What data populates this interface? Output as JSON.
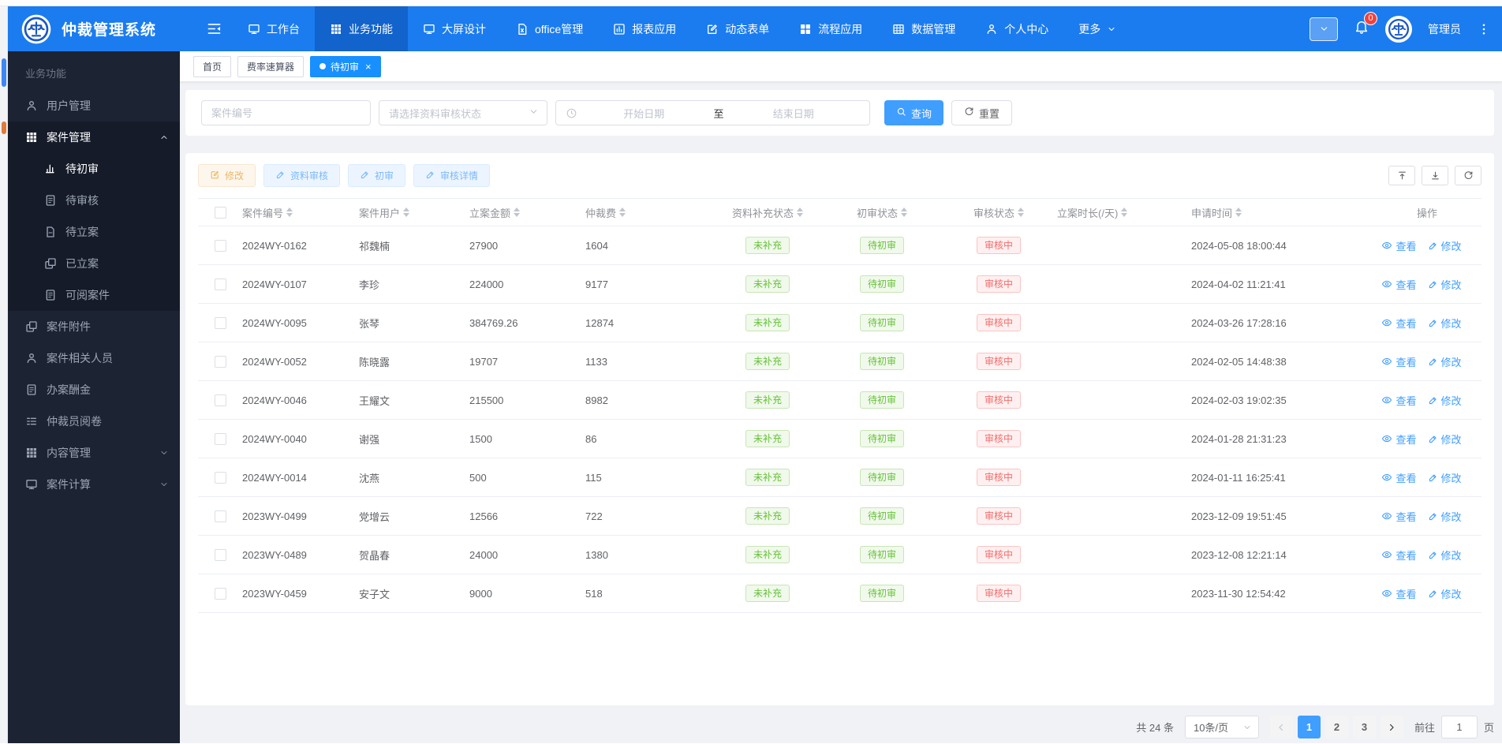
{
  "app": {
    "title": "仲裁管理系统"
  },
  "colors": {
    "navbar_blue": "#1b7cf0",
    "navbar_active_blue": "#1263cb",
    "primary": "#409eff",
    "tab_active_blue": "#1890ff",
    "sidebar_bg": "#1c2333",
    "badge_green": "#67c23a",
    "badge_green_bg": "#f0f9eb",
    "badge_red": "#f56c6c",
    "badge_red_bg": "#fef0f0",
    "warn_orange": "#ecb869",
    "notification_red": "#f5413d"
  },
  "navbar": {
    "items": [
      {
        "id": "workbench",
        "label": "工作台",
        "icon": "monitor"
      },
      {
        "id": "business",
        "label": "业务功能",
        "icon": "grid",
        "active": true
      },
      {
        "id": "screen-design",
        "label": "大屏设计",
        "icon": "monitor"
      },
      {
        "id": "office",
        "label": "office管理",
        "icon": "file-x"
      },
      {
        "id": "report",
        "label": "报表应用",
        "icon": "bar-chart"
      },
      {
        "id": "dynamic-form",
        "label": "动态表单",
        "icon": "edit"
      },
      {
        "id": "workflow",
        "label": "流程应用",
        "icon": "blocks"
      },
      {
        "id": "data-mgmt",
        "label": "数据管理",
        "icon": "table"
      },
      {
        "id": "profile",
        "label": "个人中心",
        "icon": "user"
      },
      {
        "id": "more",
        "label": "更多",
        "chevron": true
      }
    ],
    "notification_count": "0",
    "username": "管理员"
  },
  "sidebar": {
    "section_title": "业务功能",
    "items": [
      {
        "id": "user-mgmt",
        "label": "用户管理",
        "icon": "user"
      },
      {
        "id": "case-mgmt",
        "label": "案件管理",
        "icon": "grid",
        "expanded": true,
        "active": true,
        "children": [
          {
            "id": "pending-initial-review",
            "label": "待初审",
            "icon": "chart",
            "active": true
          },
          {
            "id": "pending-review",
            "label": "待审核",
            "icon": "doc-lines"
          },
          {
            "id": "pending-filing",
            "label": "待立案",
            "icon": "doc"
          },
          {
            "id": "filed",
            "label": "已立案",
            "icon": "copy"
          },
          {
            "id": "readable-cases",
            "label": "可阅案件",
            "icon": "doc-lines"
          }
        ]
      },
      {
        "id": "case-attachments",
        "label": "案件附件",
        "icon": "copy"
      },
      {
        "id": "case-related-persons",
        "label": "案件相关人员",
        "icon": "user"
      },
      {
        "id": "case-remuneration",
        "label": "办案酬金",
        "icon": "doc-lines"
      },
      {
        "id": "arbitrator-file-review",
        "label": "仲裁员阅卷",
        "icon": "list"
      },
      {
        "id": "content-mgmt",
        "label": "内容管理",
        "icon": "grid",
        "collapsed": true
      },
      {
        "id": "case-calculation",
        "label": "案件计算",
        "icon": "monitor",
        "collapsed": true
      }
    ]
  },
  "tabs": [
    {
      "id": "home",
      "label": "首页"
    },
    {
      "id": "rate-calculator",
      "label": "费率速算器"
    },
    {
      "id": "pending-initial-review",
      "label": "待初审",
      "active": true,
      "closable": true
    }
  ],
  "search": {
    "case_no_placeholder": "案件编号",
    "status_placeholder": "请选择资料审核状态",
    "start_date_placeholder": "开始日期",
    "date_separator": "至",
    "end_date_placeholder": "结束日期",
    "search_label": "查询",
    "reset_label": "重置"
  },
  "toolbar": {
    "buttons": [
      {
        "id": "edit",
        "label": "修改",
        "style": "warn",
        "icon": "edit"
      },
      {
        "id": "material-review",
        "label": "资料审核",
        "style": "blue",
        "icon": "pencil"
      },
      {
        "id": "initial-review",
        "label": "初审",
        "style": "blue",
        "icon": "pencil"
      },
      {
        "id": "review-detail",
        "label": "审核详情",
        "style": "blue",
        "icon": "pencil"
      }
    ]
  },
  "table": {
    "columns": [
      {
        "key": "select",
        "label": "",
        "type": "select"
      },
      {
        "key": "case_no",
        "label": "案件编号",
        "sortable": true,
        "type": "text"
      },
      {
        "key": "user",
        "label": "案件用户",
        "sortable": true,
        "type": "text"
      },
      {
        "key": "amount",
        "label": "立案金额",
        "sortable": true,
        "type": "text"
      },
      {
        "key": "fee",
        "label": "仲裁费",
        "sortable": true,
        "type": "text"
      },
      {
        "key": "supplement_status",
        "label": "资料补充状态",
        "sortable": true,
        "type": "badge"
      },
      {
        "key": "initial_status",
        "label": "初审状态",
        "sortable": true,
        "type": "badge"
      },
      {
        "key": "review_status",
        "label": "审核状态",
        "sortable": true,
        "type": "badge"
      },
      {
        "key": "duration_days",
        "label": "立案时长(/天)",
        "sortable": true,
        "type": "text"
      },
      {
        "key": "apply_time",
        "label": "申请时间",
        "sortable": true,
        "type": "text"
      },
      {
        "key": "actions",
        "label": "操作",
        "type": "actions"
      }
    ],
    "status_colors": {
      "未补充": "green",
      "待初审": "green",
      "审核中": "red"
    },
    "action_labels": {
      "view": "查看",
      "edit": "修改"
    },
    "rows": [
      {
        "case_no": "2024WY-0162",
        "user": "祁魏楠",
        "amount": "27900",
        "fee": "1604",
        "supplement_status": "未补充",
        "initial_status": "待初审",
        "review_status": "审核中",
        "duration_days": "",
        "apply_time": "2024-05-08 18:00:44"
      },
      {
        "case_no": "2024WY-0107",
        "user": "李珍",
        "amount": "224000",
        "fee": "9177",
        "supplement_status": "未补充",
        "initial_status": "待初审",
        "review_status": "审核中",
        "duration_days": "",
        "apply_time": "2024-04-02 11:21:41"
      },
      {
        "case_no": "2024WY-0095",
        "user": "张琴",
        "amount": "384769.26",
        "fee": "12874",
        "supplement_status": "未补充",
        "initial_status": "待初审",
        "review_status": "审核中",
        "duration_days": "",
        "apply_time": "2024-03-26 17:28:16"
      },
      {
        "case_no": "2024WY-0052",
        "user": "陈晓露",
        "amount": "19707",
        "fee": "1133",
        "supplement_status": "未补充",
        "initial_status": "待初审",
        "review_status": "审核中",
        "duration_days": "",
        "apply_time": "2024-02-05 14:48:38"
      },
      {
        "case_no": "2024WY-0046",
        "user": "王耀文",
        "amount": "215500",
        "fee": "8982",
        "supplement_status": "未补充",
        "initial_status": "待初审",
        "review_status": "审核中",
        "duration_days": "",
        "apply_time": "2024-02-03 19:02:35"
      },
      {
        "case_no": "2024WY-0040",
        "user": "谢强",
        "amount": "1500",
        "fee": "86",
        "supplement_status": "未补充",
        "initial_status": "待初审",
        "review_status": "审核中",
        "duration_days": "",
        "apply_time": "2024-01-28 21:31:23"
      },
      {
        "case_no": "2024WY-0014",
        "user": "沈燕",
        "amount": "500",
        "fee": "115",
        "supplement_status": "未补充",
        "initial_status": "待初审",
        "review_status": "审核中",
        "duration_days": "",
        "apply_time": "2024-01-11 16:25:41"
      },
      {
        "case_no": "2023WY-0499",
        "user": "党增云",
        "amount": "12566",
        "fee": "722",
        "supplement_status": "未补充",
        "initial_status": "待初审",
        "review_status": "审核中",
        "duration_days": "",
        "apply_time": "2023-12-09 19:51:45"
      },
      {
        "case_no": "2023WY-0489",
        "user": "贺晶春",
        "amount": "24000",
        "fee": "1380",
        "supplement_status": "未补充",
        "initial_status": "待初审",
        "review_status": "审核中",
        "duration_days": "",
        "apply_time": "2023-12-08 12:21:14"
      },
      {
        "case_no": "2023WY-0459",
        "user": "安子文",
        "amount": "9000",
        "fee": "518",
        "supplement_status": "未补充",
        "initial_status": "待初审",
        "review_status": "审核中",
        "duration_days": "",
        "apply_time": "2023-11-30 12:54:42"
      }
    ]
  },
  "pagination": {
    "total_label": "共 24 条",
    "page_size_label": "10条/页",
    "pages": [
      "1",
      "2",
      "3"
    ],
    "active_page": "1",
    "goto_label": "前往",
    "goto_value": "1",
    "page_unit": "页"
  }
}
